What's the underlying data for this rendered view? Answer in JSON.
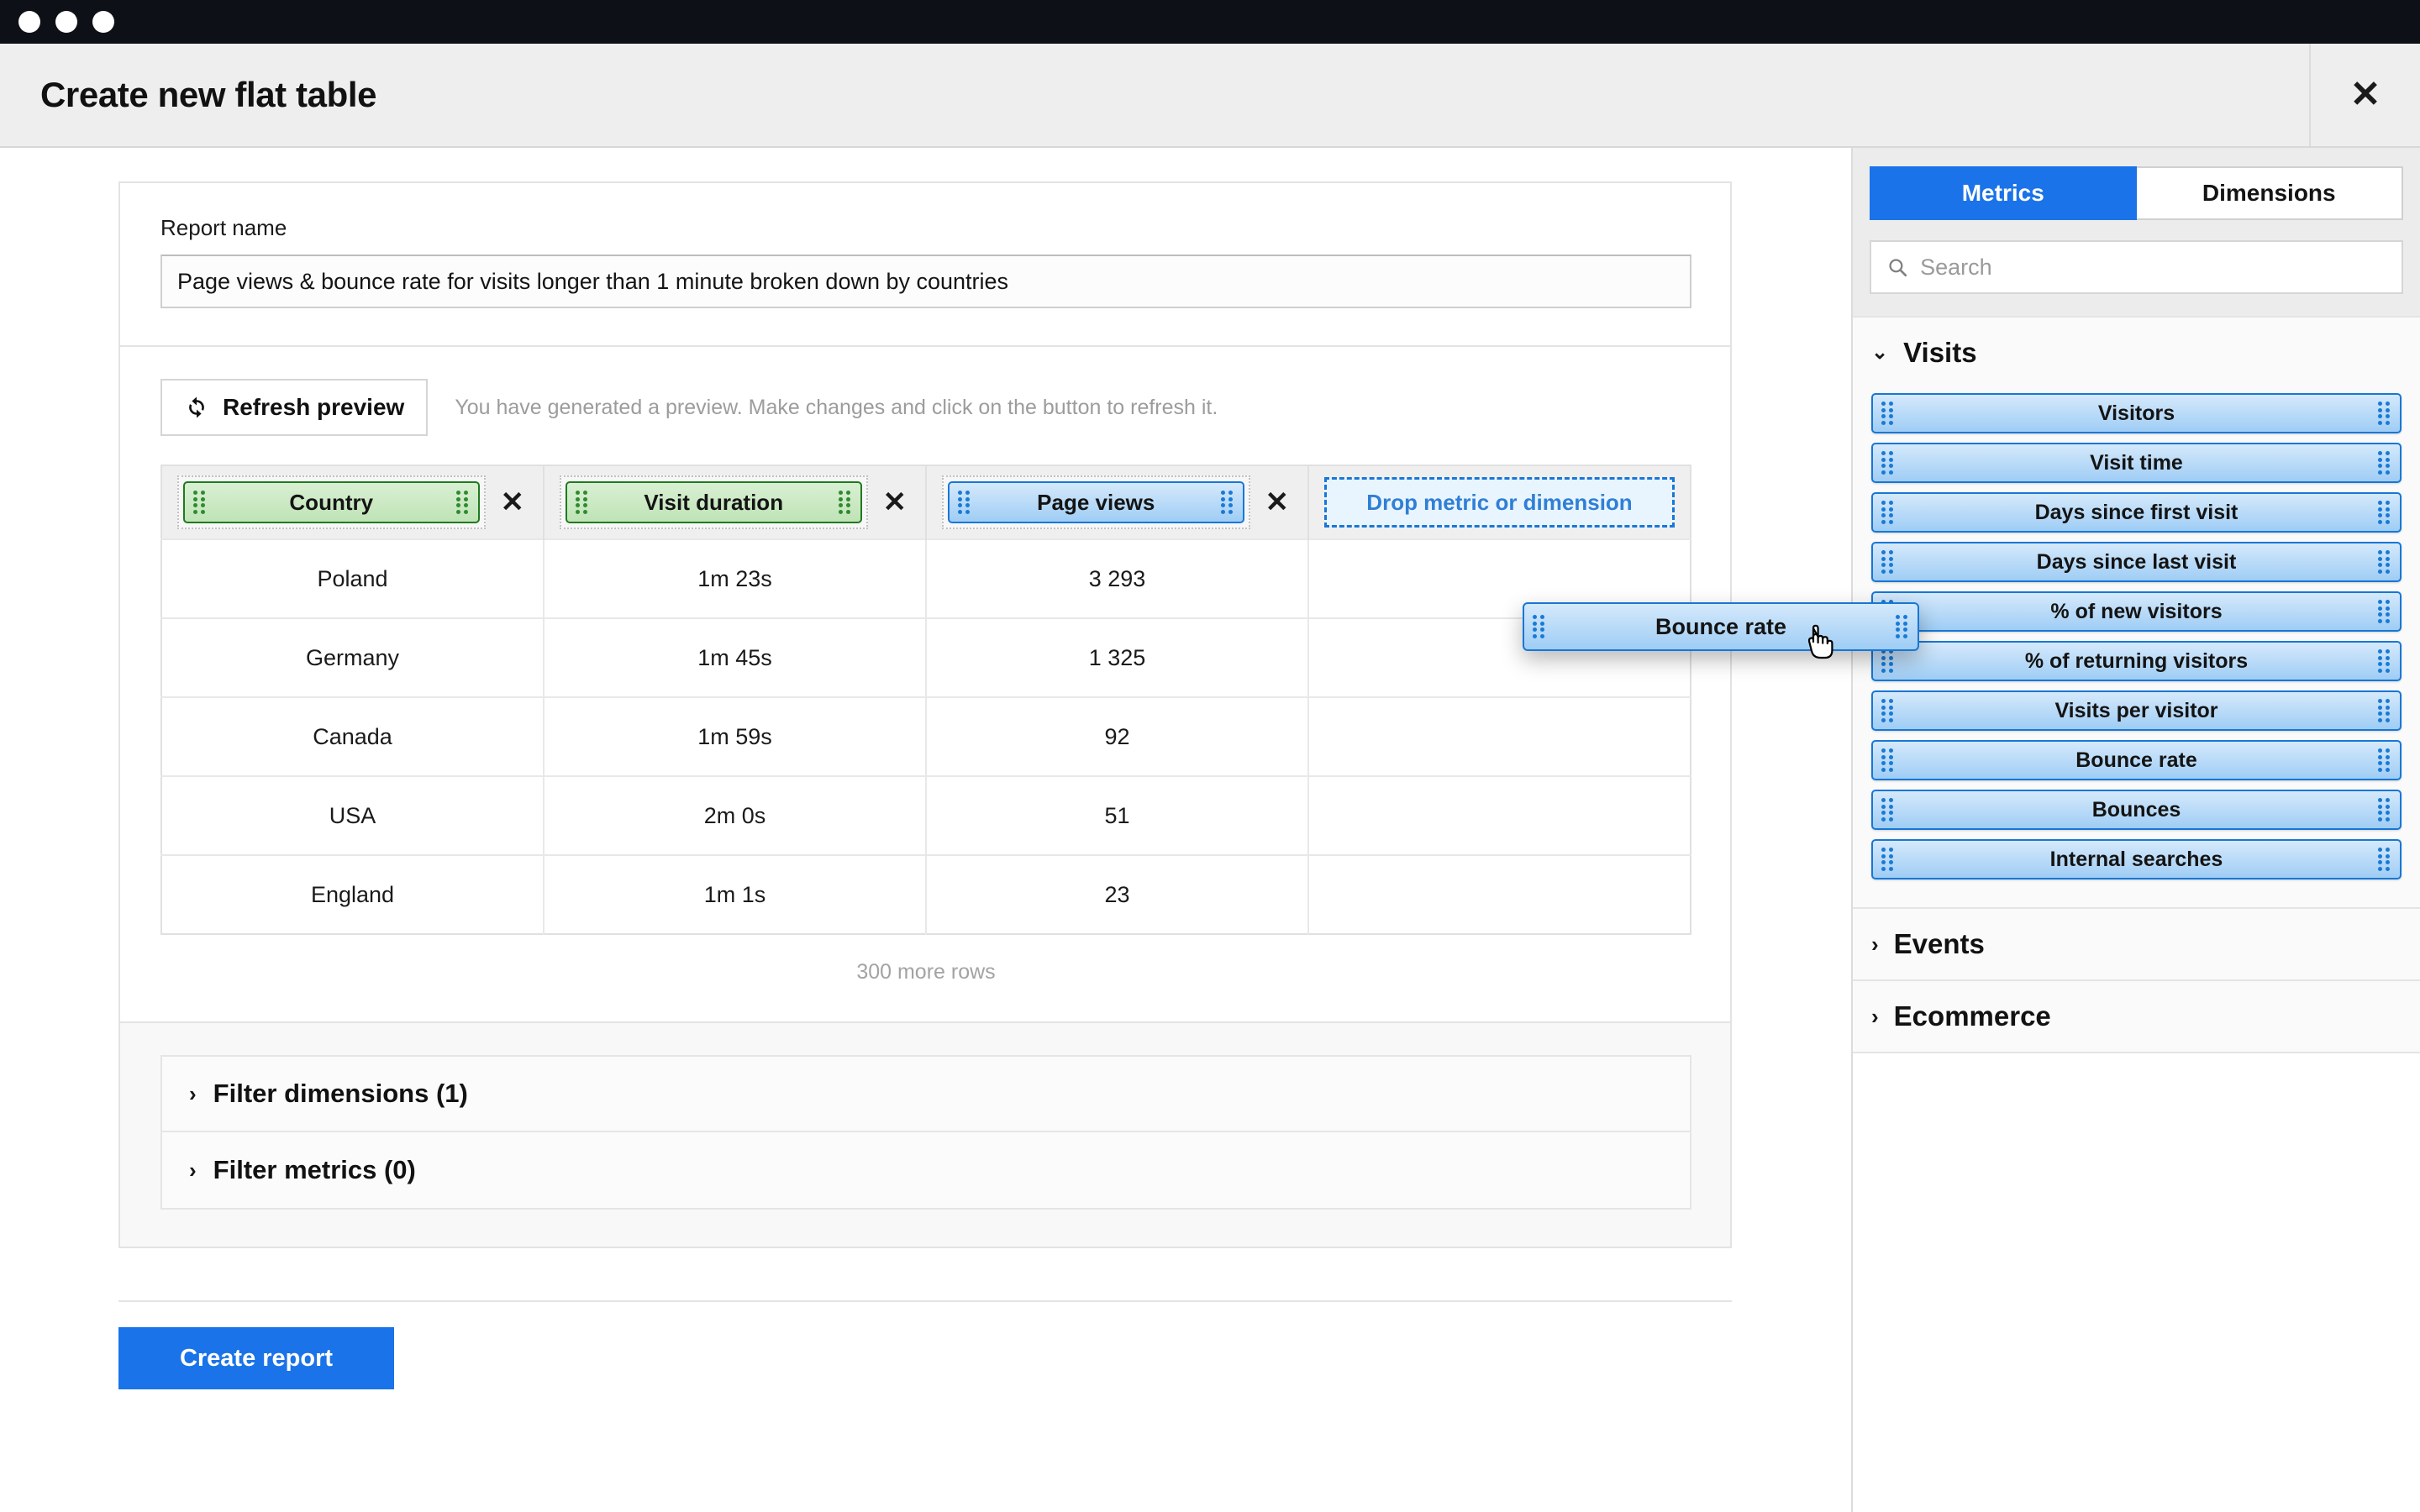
{
  "window": {
    "traffic_lights": [
      "dot-1",
      "dot-2",
      "dot-3"
    ]
  },
  "header": {
    "title": "Create new flat table",
    "close_icon": "close-icon",
    "close_glyph": "✕"
  },
  "form": {
    "report_name_label": "Report name",
    "report_name_value": "Page views & bounce rate for visits longer than 1 minute broken down by countries",
    "report_name_placeholder": "Report name"
  },
  "preview": {
    "refresh_button_label": "Refresh preview",
    "refresh_icon": "refresh-icon",
    "hint": "You have generated a preview. Make changes and click on the button to refresh it.",
    "more_rows": "300 more rows",
    "dropzone_label": "Drop metric or dimension",
    "remove_glyph": "✕",
    "columns": [
      {
        "label": "Country",
        "kind": "dimension",
        "removable": true
      },
      {
        "label": "Visit duration",
        "kind": "dimension",
        "removable": true
      },
      {
        "label": "Page views",
        "kind": "metric",
        "removable": true
      },
      {
        "label": "Drop metric or dimension",
        "kind": "dropzone",
        "removable": false
      }
    ],
    "rows": [
      [
        "Poland",
        "1m 23s",
        "3 293",
        ""
      ],
      [
        "Germany",
        "1m 45s",
        "1 325",
        ""
      ],
      [
        "Canada",
        "1m 59s",
        "92",
        ""
      ],
      [
        "USA",
        "2m 0s",
        "51",
        ""
      ],
      [
        "England",
        "1m 1s",
        "23",
        ""
      ]
    ]
  },
  "filters": {
    "caret_glyph": "›",
    "items": [
      {
        "label": "Filter dimensions (1)",
        "name": "filter-dimensions"
      },
      {
        "label": "Filter metrics (0)",
        "name": "filter-metrics"
      }
    ]
  },
  "footer": {
    "create_report_label": "Create report"
  },
  "sidebar": {
    "tabs": [
      {
        "label": "Metrics",
        "active": true
      },
      {
        "label": "Dimensions",
        "active": false
      }
    ],
    "search": {
      "placeholder": "Search",
      "value": "",
      "icon": "search-icon"
    },
    "groups": [
      {
        "label": "Visits",
        "expanded": true,
        "caret_glyph": "⌄",
        "items": [
          "Visitors",
          "Visit time",
          "Days since first visit",
          "Days since last visit",
          "% of new visitors",
          "% of returning visitors",
          "Visits per visitor",
          "Bounce rate",
          "Bounces",
          "Internal searches"
        ]
      },
      {
        "label": "Events",
        "expanded": false,
        "caret_glyph": "›",
        "items": []
      },
      {
        "label": "Ecommerce",
        "expanded": false,
        "caret_glyph": "›",
        "items": []
      }
    ]
  },
  "drag": {
    "ghost_label": "Bounce rate",
    "cursor": "grabbing-hand-cursor"
  },
  "colors": {
    "accent_blue": "#1a73e8",
    "chip_metric_border": "#1777d6",
    "chip_dimension_border": "#1f7a1f",
    "titlebar": "#0d1117",
    "modal_header_bg": "#eeeeee",
    "dropzone_text": "#2f7fd6"
  }
}
